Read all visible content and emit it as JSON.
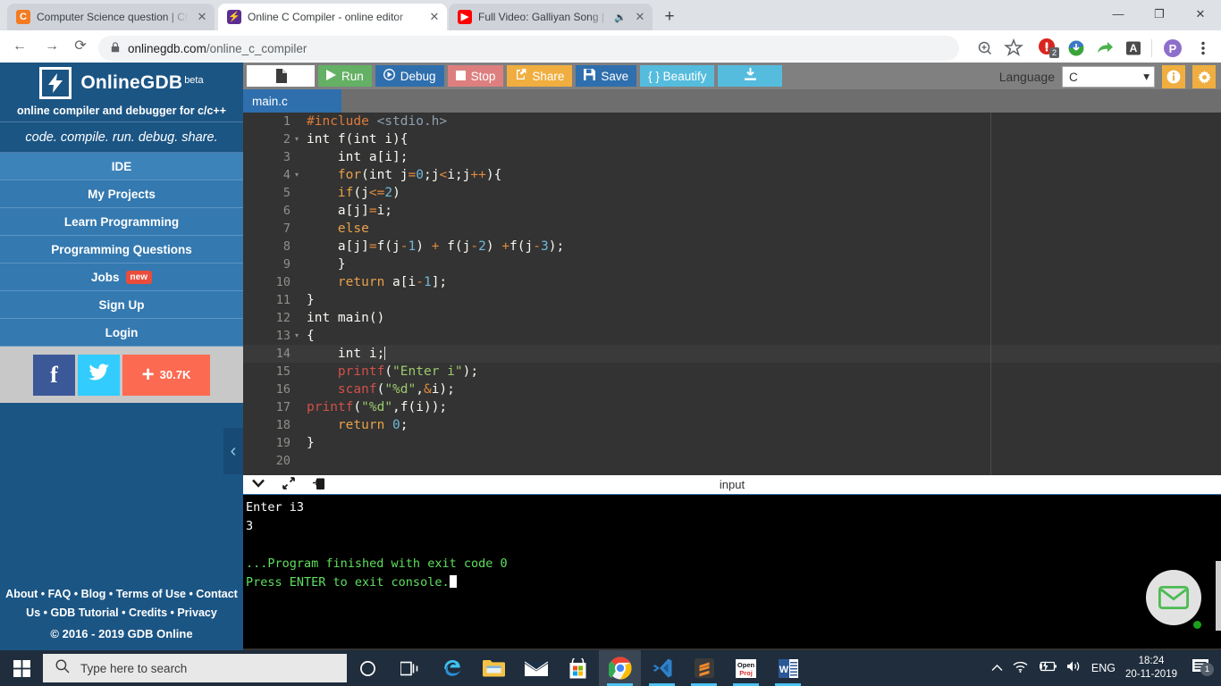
{
  "browser": {
    "tabs": [
      {
        "title": "Computer Science question | Che",
        "favicon_name": "chegg-icon",
        "favicon_color": "#f47b20",
        "favicon_letter": "C",
        "active": false,
        "has_audio": false
      },
      {
        "title": "Online C Compiler - online editor",
        "favicon_name": "onlinegdb-icon",
        "favicon_color": "#5c2d91",
        "favicon_letter": "⚡",
        "active": true,
        "has_audio": false
      },
      {
        "title": "Full Video: Galliyan Song | Ek",
        "favicon_name": "youtube-icon",
        "favicon_color": "#ff0000",
        "favicon_letter": "▶",
        "active": false,
        "has_audio": true
      }
    ],
    "new_tab_label": "+",
    "window": {
      "minimize": "—",
      "restore": "❐",
      "close": "✕"
    },
    "nav": {
      "back": "←",
      "forward": "→",
      "reload": "⟳"
    },
    "url": {
      "lock": "🔒",
      "domain": "onlinegdb.com",
      "path": "/online_c_compiler"
    },
    "extensions": [
      {
        "name": "zoom-icon",
        "glyph": "⊕"
      },
      {
        "name": "bookmark-star-icon",
        "glyph": "☆"
      },
      {
        "name": "adblock-icon",
        "badge": "2"
      },
      {
        "name": "download-manager-icon"
      },
      {
        "name": "share-icon",
        "glyph": "➦"
      },
      {
        "name": "grammarly-icon",
        "glyph": "A"
      },
      {
        "name": "profile-avatar",
        "glyph": "P"
      },
      {
        "name": "chrome-menu-icon",
        "glyph": "⋮"
      }
    ]
  },
  "sidebar": {
    "brand_name": "OnlineGDB",
    "beta_label": "beta",
    "tagline": "online compiler and debugger for c/c++",
    "slogan": "code. compile. run. debug. share.",
    "nav_items": [
      {
        "label": "IDE",
        "badge": null
      },
      {
        "label": "My Projects",
        "badge": null
      },
      {
        "label": "Learn Programming",
        "badge": null
      },
      {
        "label": "Programming Questions",
        "badge": null
      },
      {
        "label": "Jobs",
        "badge": "new"
      },
      {
        "label": "Sign Up",
        "badge": null
      },
      {
        "label": "Login",
        "badge": null
      }
    ],
    "social": [
      {
        "name": "facebook-share-button",
        "label": "f"
      },
      {
        "name": "twitter-share-button",
        "label": ""
      },
      {
        "name": "google-plus-share-button",
        "label": "30.7K"
      }
    ],
    "collapse_glyph": "‹",
    "footer_line1": "About • FAQ • Blog • Terms of Use • Contact",
    "footer_line2": "Us • GDB Tutorial • Credits • Privacy",
    "copyright": "© 2016 - 2019 GDB Online"
  },
  "toolbar": {
    "new_file_label": "",
    "run_label": "Run",
    "debug_label": "Debug",
    "stop_label": "Stop",
    "share_label": "Share",
    "save_label": "Save",
    "beautify_label": "{ } Beautify",
    "download_label": "",
    "language_label": "Language",
    "language_value": "C",
    "dropdown_glyph": "▾",
    "info_glyph": "i",
    "settings_glyph": "⚙"
  },
  "file_tab": "main.c",
  "editor": {
    "active_line": 14,
    "lines": [
      {
        "n": 1,
        "fold": false,
        "html": "<span class='pp'>#include</span> <span class='hdr'>&lt;stdio.h&gt;</span>"
      },
      {
        "n": 2,
        "fold": true,
        "html": "int f(int i){"
      },
      {
        "n": 3,
        "fold": false,
        "html": "    int a[i];"
      },
      {
        "n": 4,
        "fold": true,
        "html": "    <span class='k'>for</span>(int j<span class='op'>=</span><span class='n'>0</span>;j<span class='op'>&lt;</span>i;j<span class='op'>++</span>){"
      },
      {
        "n": 5,
        "fold": false,
        "html": "    <span class='k'>if</span>(j<span class='op'>&lt;=</span><span class='n'>2</span>)"
      },
      {
        "n": 6,
        "fold": false,
        "html": "    a[j]<span class='op'>=</span>i;"
      },
      {
        "n": 7,
        "fold": false,
        "html": "    <span class='k'>else</span>"
      },
      {
        "n": 8,
        "fold": false,
        "html": "    a[j]<span class='op'>=</span>f(j<span class='op'>-</span><span class='n'>1</span>) <span class='op'>+</span> f(j<span class='op'>-</span><span class='n'>2</span>) <span class='op'>+</span>f(j<span class='op'>-</span><span class='n'>3</span>);"
      },
      {
        "n": 9,
        "fold": false,
        "html": "    }"
      },
      {
        "n": 10,
        "fold": false,
        "html": "    <span class='k'>return</span> a[i<span class='op'>-</span><span class='n'>1</span>];"
      },
      {
        "n": 11,
        "fold": false,
        "html": "}"
      },
      {
        "n": 12,
        "fold": false,
        "html": "int main()"
      },
      {
        "n": 13,
        "fold": true,
        "html": "{"
      },
      {
        "n": 14,
        "fold": false,
        "html": "    int i;<span class='caret'></span>"
      },
      {
        "n": 15,
        "fold": false,
        "html": "    <span class='fn'>printf</span>(<span class='s'>\"Enter i\"</span>);"
      },
      {
        "n": 16,
        "fold": false,
        "html": "    <span class='fn'>scanf</span>(<span class='s'>\"%d\"</span>,<span class='op'>&amp;</span>i);"
      },
      {
        "n": 17,
        "fold": false,
        "html": "<span class='fn'>printf</span>(<span class='s'>\"%d\"</span>,f(i));"
      },
      {
        "n": 18,
        "fold": false,
        "html": "    <span class='k'>return</span> <span class='n'>0</span>;"
      },
      {
        "n": 19,
        "fold": false,
        "html": "}"
      },
      {
        "n": 20,
        "fold": false,
        "html": ""
      }
    ]
  },
  "console": {
    "label": "input",
    "icons": [
      {
        "name": "collapse-chevron-icon",
        "glyph": "▾"
      },
      {
        "name": "expand-fullscreen-icon",
        "glyph": "⤡"
      },
      {
        "name": "copy-output-icon",
        "glyph": "⎘"
      }
    ],
    "lines": [
      {
        "text": "Enter i3",
        "type": "output"
      },
      {
        "text": "3",
        "type": "output"
      },
      {
        "text": "",
        "type": "output"
      },
      {
        "text": "...Program finished with exit code 0",
        "type": "system"
      },
      {
        "text": "Press ENTER to exit console.",
        "type": "system",
        "cursor": true
      }
    ]
  },
  "chat_widget": {
    "name": "chat-envelope-icon"
  },
  "taskbar": {
    "search_placeholder": "Type here to search",
    "apps": [
      {
        "name": "cortana-icon",
        "active": false,
        "running": false
      },
      {
        "name": "task-view-icon",
        "active": false,
        "running": false
      },
      {
        "name": "edge-icon",
        "active": false,
        "running": false
      },
      {
        "name": "file-explorer-icon",
        "active": false,
        "running": false
      },
      {
        "name": "mail-icon",
        "active": false,
        "running": false
      },
      {
        "name": "microsoft-store-icon",
        "active": false,
        "running": false
      },
      {
        "name": "chrome-icon",
        "active": true,
        "running": true
      },
      {
        "name": "vscode-icon",
        "active": false,
        "running": true
      },
      {
        "name": "sublime-text-icon",
        "active": false,
        "running": true
      },
      {
        "name": "openproj-icon",
        "active": false,
        "running": true
      },
      {
        "name": "word-icon",
        "active": false,
        "running": true
      }
    ],
    "tray": {
      "show_hidden": "∧",
      "language": "ENG",
      "time": "18:24",
      "date": "20-11-2019",
      "notification_count": "1"
    }
  }
}
